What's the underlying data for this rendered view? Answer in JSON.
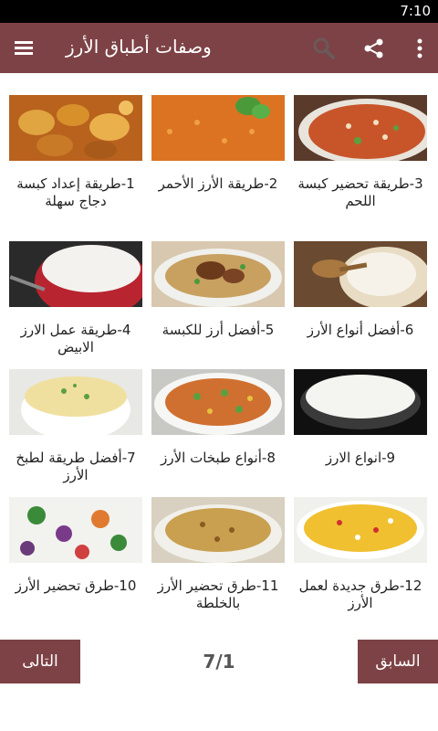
{
  "status_bar": {
    "time": "7:10"
  },
  "app_bar": {
    "title": "وصفات أطباق الأرز",
    "icons": [
      "menu-icon",
      "search-icon",
      "share-icon",
      "more-vert-icon"
    ]
  },
  "recipes": [
    {
      "label": "1-طريقة إعداد كبسة دجاج سهلة"
    },
    {
      "label": "2-طريقة الأرز الأحمر"
    },
    {
      "label": "3-طريقة تحضير كبسة اللحم"
    },
    {
      "label": "4-طريقة عمل الارز الابيض"
    },
    {
      "label": "5-أفضل أرز للكبسة"
    },
    {
      "label": "6-أفضل أنواع الأرز"
    },
    {
      "label": "7-أفضل طريقة لطبخ الأرز"
    },
    {
      "label": "8-أنواع طبخات الأرز"
    },
    {
      "label": "9-انواع الارز"
    },
    {
      "label": "10-طرق تحضير الأرز"
    },
    {
      "label": "11-طرق تحضير الأرز بالخلطة"
    },
    {
      "label": "12-طرق جديدة لعمل الأرز"
    }
  ],
  "pagination": {
    "next_label": "التالى",
    "prev_label": "السابق",
    "page_indicator": "7/1"
  },
  "colors": {
    "accent": "#7d4246",
    "status_bar": "#000000",
    "background": "#ffffff"
  }
}
